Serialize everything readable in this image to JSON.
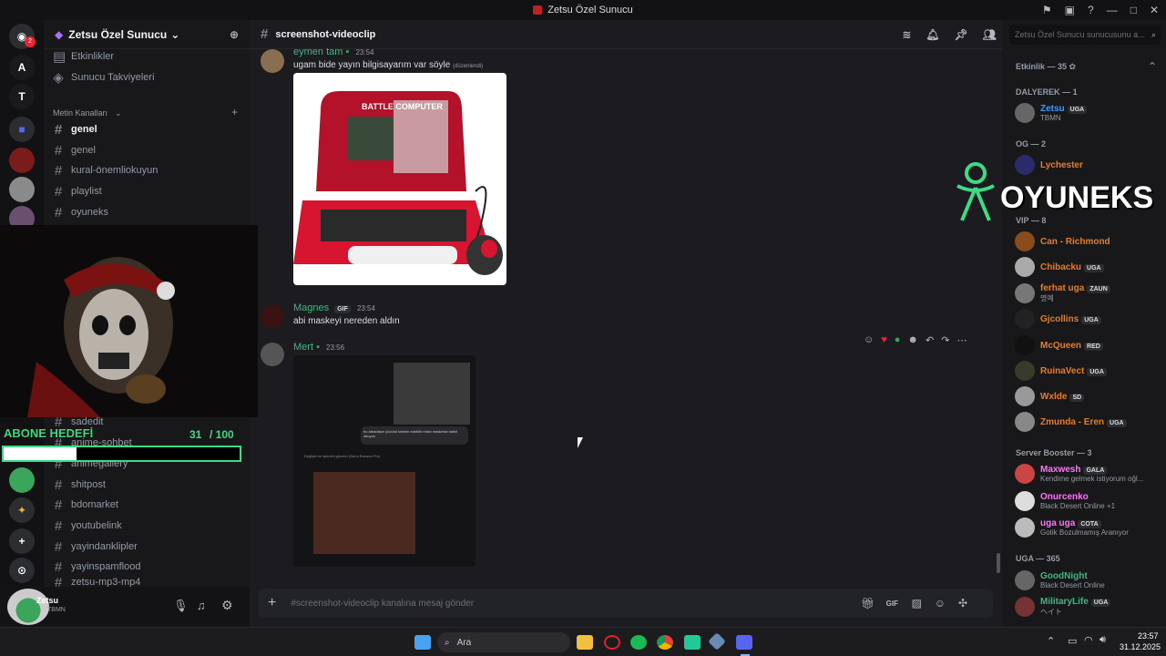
{
  "window": {
    "title": "Zetsu Özel Sunucu"
  },
  "server": {
    "name": "Zetsu Özel Sunucu",
    "top_items": [
      "Etkinlikler",
      "Sunucu Takviyeleri"
    ],
    "category": "Metin Kanalları",
    "channels": [
      "genel",
      "genel",
      "kural-önemliokuyun",
      "playlist",
      "oyuneks",
      "sadedit",
      "anime-sohbet",
      "animegallery",
      "shitpost",
      "bdomarket",
      "youtubelink",
      "yayindanklipler",
      "yayinspamflood",
      "zetsu-mp3-mp4"
    ],
    "rail_letters": [
      "A",
      "T"
    ],
    "rail_badge": "2"
  },
  "channel_header": {
    "name": "screenshot-videoclip"
  },
  "messages": [
    {
      "author": "eymen tam",
      "time": "23:54",
      "text": "ugam bide yayın bilgisayarım  var söyle",
      "edited": "(düzenlendi)",
      "image_title": "BATTLE COMPUTER"
    },
    {
      "author": "Magnes",
      "badge": "GIF",
      "time": "23:54",
      "text": "abi maskeyi nereden aldın"
    },
    {
      "author": "Mert",
      "time": "23:56",
      "embed_text": "bu arkadaşın yüzünü tahmin edebilir misin maskesiz halini okuyun",
      "embed_sub": "Değiştirme işlemini gözden (Nano Banana Pro)"
    }
  ],
  "composer": {
    "placeholder": "#screenshot-videoclip kanalına mesaj gönder"
  },
  "members": {
    "search_placeholder": "Zetsu Özel Sunucu sunucusunu a...",
    "activity_label": "Etkinlik — 35",
    "groups": [
      {
        "label": "DALYEREK — 1",
        "members": [
          {
            "name": "Zetsu",
            "tag": "UGA",
            "sub": "TBMN",
            "color": "#3b9cff"
          }
        ]
      },
      {
        "label": "OG — 2",
        "members": [
          {
            "name": "Lychester",
            "tag": "",
            "sub": "",
            "color": "#e67e22"
          }
        ]
      },
      {
        "label": "VIP — 8",
        "members": [
          {
            "name": "Can - Richmond",
            "tag": "",
            "sub": "",
            "color": "#e67e22"
          },
          {
            "name": "Chibacku",
            "tag": "UGA",
            "sub": "",
            "color": "#e67e22"
          },
          {
            "name": "ferhat uga",
            "tag": "ZAUN",
            "sub": "명예",
            "color": "#e67e22"
          },
          {
            "name": "Gjcollins",
            "tag": "UGA",
            "sub": "",
            "color": "#e67e22"
          },
          {
            "name": "McQueen",
            "tag": "RED",
            "sub": "",
            "color": "#e67e22"
          },
          {
            "name": "RuinaVect",
            "tag": "UGA",
            "sub": "",
            "color": "#e67e22"
          },
          {
            "name": "Wxlde",
            "tag": "SD",
            "sub": "",
            "color": "#e67e22"
          },
          {
            "name": "Zmunda - Eren",
            "tag": "UGA",
            "sub": "",
            "color": "#e67e22"
          }
        ]
      },
      {
        "label": "Server Booster — 3",
        "members": [
          {
            "name": "Maxwesh",
            "tag": "GALA",
            "sub": "Kendime gelmek istiyorum oğl...",
            "color": "#ff73fa"
          },
          {
            "name": "Onurcenko",
            "tag": "",
            "sub": "Black Desert Online +1",
            "color": "#ff73fa"
          },
          {
            "name": "uga uga",
            "tag": "COTA",
            "sub": "Gotik Bozulmamış Aranıyor",
            "color": "#ff73fa"
          }
        ]
      },
      {
        "label": "UGA — 365",
        "members": [
          {
            "name": "GoodNight",
            "tag": "",
            "sub": "Black Desert Online",
            "color": "#43b581"
          },
          {
            "name": "MilitaryLife",
            "tag": "UGA",
            "sub": "ヘイト",
            "color": "#43b581"
          }
        ]
      }
    ]
  },
  "overlay": {
    "brand": "OYUNEKS",
    "goal_label": "ABONE HEDEFİ",
    "goal_current": "31",
    "goal_target": "/ 100",
    "goal_fraction": 0.31
  },
  "user_panel": {
    "name": "Zetsu",
    "status": "TBMN"
  },
  "taskbar": {
    "search": "Ara",
    "time": "23:57",
    "date": "31.12.2025"
  }
}
